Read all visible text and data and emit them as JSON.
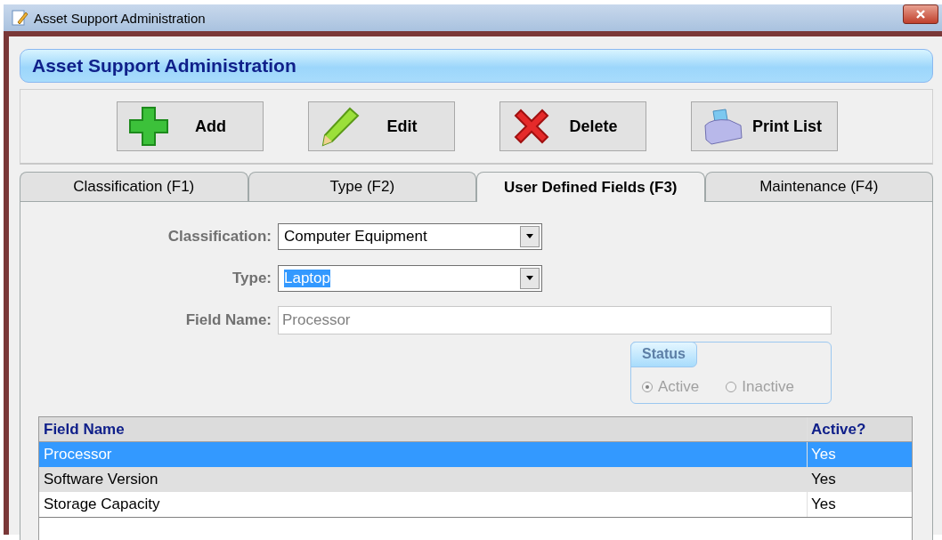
{
  "window": {
    "title": "Asset Support Administration"
  },
  "header": {
    "title": "Asset Support Administration"
  },
  "toolbar": [
    {
      "label": "Add",
      "kind": "add"
    },
    {
      "label": "Edit",
      "kind": "edit"
    },
    {
      "label": "Delete",
      "kind": "delete"
    },
    {
      "label": "Print List",
      "kind": "print"
    }
  ],
  "tabs": [
    {
      "label": "Classification (F1)",
      "selected": false
    },
    {
      "label": "Type (F2)",
      "selected": false
    },
    {
      "label": "User Defined Fields (F3)",
      "selected": true
    },
    {
      "label": "Maintenance (F4)",
      "selected": false
    }
  ],
  "form": {
    "fields": [
      {
        "label": "Classification:",
        "value": "Computer Equipment",
        "kind": "dropdown",
        "highlighted": false
      },
      {
        "label": "Type:",
        "value": "Laptop",
        "kind": "dropdown",
        "highlighted": true
      },
      {
        "label": "Field Name:",
        "value": "Processor",
        "kind": "text",
        "disabled": true
      }
    ],
    "status": {
      "title": "Status",
      "disabled": true,
      "options": [
        {
          "label": "Active",
          "selected": true
        },
        {
          "label": "Inactive",
          "selected": false
        }
      ]
    }
  },
  "table": {
    "columns": [
      "Field Name",
      "Active?"
    ],
    "rows": [
      {
        "cells": [
          "Processor",
          "Yes"
        ],
        "selected": true
      },
      {
        "cells": [
          "Software Version",
          "Yes"
        ],
        "selected": false
      },
      {
        "cells": [
          "Storage Capacity",
          "Yes"
        ],
        "selected": false
      }
    ]
  }
}
